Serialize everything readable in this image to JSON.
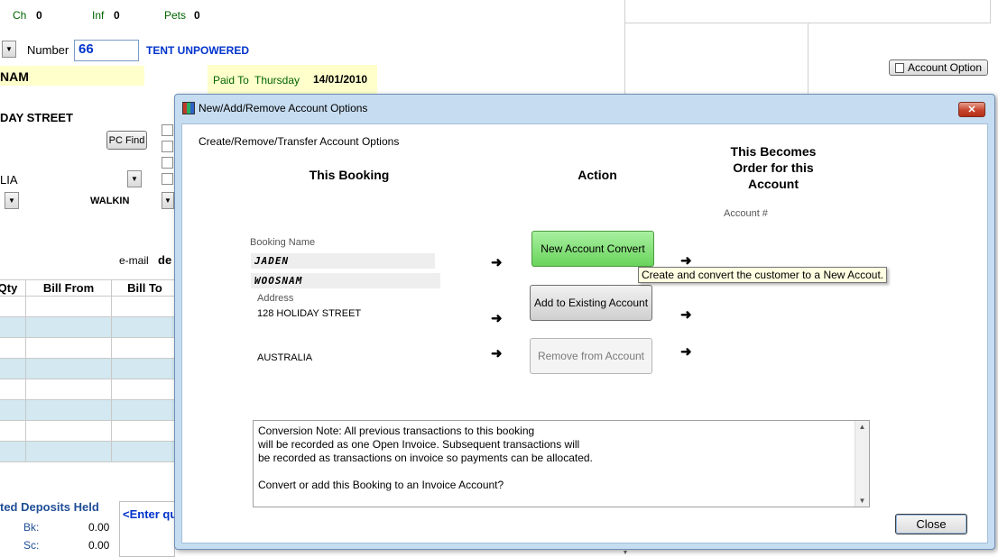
{
  "background": {
    "counts": [
      {
        "label": "Ch",
        "value": "0"
      },
      {
        "label": "Inf",
        "value": "0"
      },
      {
        "label": "Pets",
        "value": "0"
      }
    ],
    "number_label": "Number",
    "number_value": "66",
    "site_type": "TENT UNPOWERED",
    "name_fragment": "NAM",
    "paid_to_label": "Paid To",
    "paid_to_day": "Thursday",
    "paid_to_date": "14/01/2010",
    "street_fragment": "DAY STREET",
    "pc_find_label": "PC Find",
    "country_fragment": "LIA",
    "source": "WALKIN",
    "email_label": "e-mail",
    "email_fragment": "de",
    "account_option_label": "Account Option",
    "grid_headers": [
      "Qty",
      "Bill From",
      "Bill To"
    ],
    "grid_rows": 8,
    "deposits_title": "ted Deposits Held",
    "deposits": [
      {
        "label": "Bk:",
        "value": "0.00"
      },
      {
        "label": "Sc:",
        "value": "0.00"
      }
    ],
    "enter_prompt": "<Enter qu"
  },
  "dialog": {
    "title": "New/Add/Remove  Account Options",
    "close_glyph": "✕",
    "subtitle": "Create/Remove/Transfer  Account Options",
    "col_this_booking": "This Booking",
    "col_action": "Action",
    "col_becomes": "This Becomes Order for this Account",
    "account_num_label": "Account #",
    "booking_name_label": "Booking Name",
    "first_name": "JADEN",
    "last_name": "WOOSNAM",
    "address_label": "Address",
    "address_line": "128 HOLIDAY STREET",
    "country": "AUSTRALIA",
    "arrow": "➜",
    "btn_new": "New Account Convert",
    "btn_add": "Add to Existing Account",
    "btn_remove": "Remove from  Account",
    "tooltip": "Create and convert the customer to a New Accout.",
    "note_lines": [
      "Conversion Note: All previous transactions to this booking",
      "will be recorded as one Open Invoice. Subsequent transactions will",
      "be recorded as transactions on invoice so payments can be allocated.",
      "",
      "Convert or add this Booking to an Invoice Account?"
    ],
    "close_label": "Close"
  }
}
